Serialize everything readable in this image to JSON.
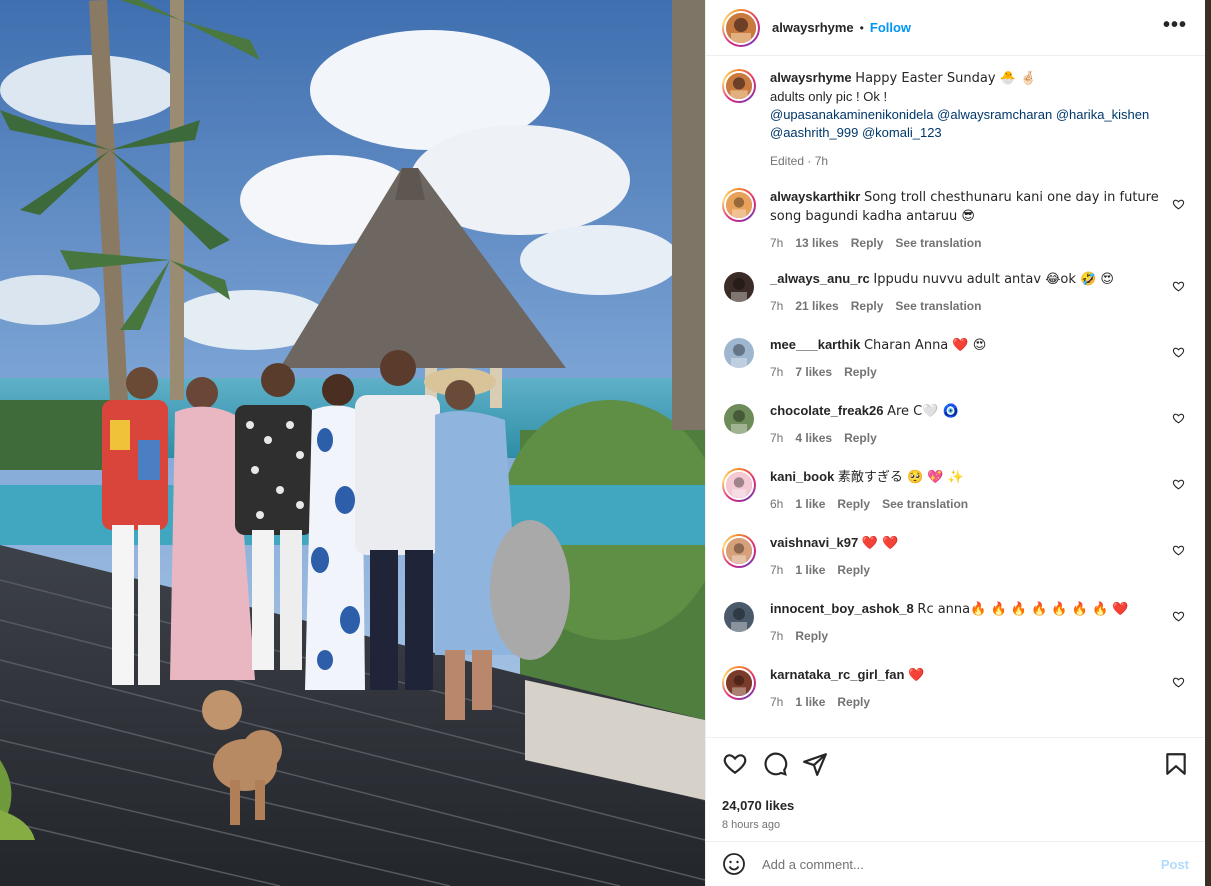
{
  "post": {
    "author": "alwaysrhyme",
    "follow_label": "Follow",
    "more_label": "•••",
    "caption": {
      "user": "alwaysrhyme",
      "line1": "Happy Easter Sunday 🐣 🤞🏻",
      "line2": "adults only pic ! Ok !",
      "mentions_line1": "@upasanakaminenikonidela @alwaysramcharan @harika_kishen",
      "mentions_line2": "@aashrith_999 @komali_123",
      "edited": "Edited · 7h"
    },
    "comments": [
      {
        "user": "alwayskarthikr",
        "text": "Song troll chesthunaru kani one day in future song bagundi kadha antaruu 😎",
        "time": "7h",
        "likes": "13 likes",
        "reply": "Reply",
        "translate": "See translation"
      },
      {
        "user": "_always_anu_rc",
        "text": "Ippudu nuvvu adult antav 😂ok 🤣 😍",
        "time": "7h",
        "likes": "21 likes",
        "reply": "Reply",
        "translate": "See translation"
      },
      {
        "user": "mee___karthik",
        "text": "Charan Anna ❤️ 😍",
        "time": "7h",
        "likes": "7 likes",
        "reply": "Reply",
        "translate": ""
      },
      {
        "user": "chocolate_freak26",
        "text": "Are C🤍 🧿",
        "time": "7h",
        "likes": "4 likes",
        "reply": "Reply",
        "translate": ""
      },
      {
        "user": "kani_book",
        "text": "素敵すぎる 🥺 💖 ✨",
        "time": "6h",
        "likes": "1 like",
        "reply": "Reply",
        "translate": "See translation"
      },
      {
        "user": "vaishnavi_k97",
        "text": "❤️ ❤️",
        "time": "7h",
        "likes": "1 like",
        "reply": "Reply",
        "translate": ""
      },
      {
        "user": "innocent_boy_ashok_8",
        "text": "Rc anna🔥 🔥 🔥 🔥 🔥 🔥 🔥 ❤️",
        "time": "7h",
        "likes": "",
        "reply": "Reply",
        "translate": ""
      },
      {
        "user": "karnataka_rc_girl_fan",
        "text": "❤️",
        "time": "7h",
        "likes": "1 like",
        "reply": "Reply",
        "translate": ""
      }
    ],
    "likes_count": "24,070 likes",
    "posted_ago": "8 hours ago",
    "comment_placeholder": "Add a comment...",
    "post_label": "Post"
  },
  "colors": {
    "accent": "#0095f6",
    "mention": "#00376b",
    "muted": "#737373"
  }
}
